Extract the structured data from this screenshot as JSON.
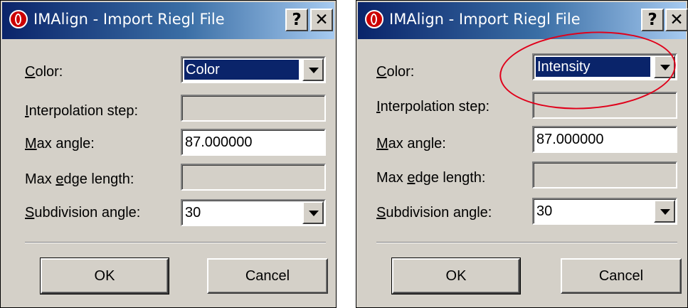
{
  "dialogs": [
    {
      "title": "IMAlign - Import Riegl File",
      "help_label": "?",
      "close_label": "✕",
      "color": {
        "label_underline": "C",
        "label_rest": "olor:",
        "value": "Color"
      },
      "interpolation_step": {
        "label_underline": "I",
        "label_rest": "nterpolation step:",
        "value": ""
      },
      "max_angle": {
        "label_underline": "M",
        "label_rest": "ax angle:",
        "value": "87.000000"
      },
      "max_edge_length": {
        "label_before": "Max ",
        "label_underline": "e",
        "label_rest": "dge length:",
        "value": ""
      },
      "subdivision_angle": {
        "label_underline": "S",
        "label_rest": "ubdivision angle:",
        "value": "30"
      },
      "ok_label": "OK",
      "cancel_label": "Cancel"
    },
    {
      "title": "IMAlign - Import Riegl File",
      "help_label": "?",
      "close_label": "✕",
      "color": {
        "label_underline": "C",
        "label_rest": "olor:",
        "value": "Intensity"
      },
      "interpolation_step": {
        "label_underline": "I",
        "label_rest": "nterpolation step:",
        "value": ""
      },
      "max_angle": {
        "label_underline": "M",
        "label_rest": "ax angle:",
        "value": "87.000000"
      },
      "max_edge_length": {
        "label_before": "Max ",
        "label_underline": "e",
        "label_rest": "dge length:",
        "value": ""
      },
      "subdivision_angle": {
        "label_underline": "S",
        "label_rest": "ubdivision angle:",
        "value": "30"
      },
      "ok_label": "OK",
      "cancel_label": "Cancel"
    }
  ],
  "annotation": {
    "color": "#e0001a",
    "shape": "ellipse",
    "target": "color dropdown in second dialog"
  },
  "colors": {
    "titlebar_start": "#0a246a",
    "titlebar_end": "#a6caf0",
    "dialog_face": "#d4d0c8",
    "selection": "#0a246a"
  }
}
